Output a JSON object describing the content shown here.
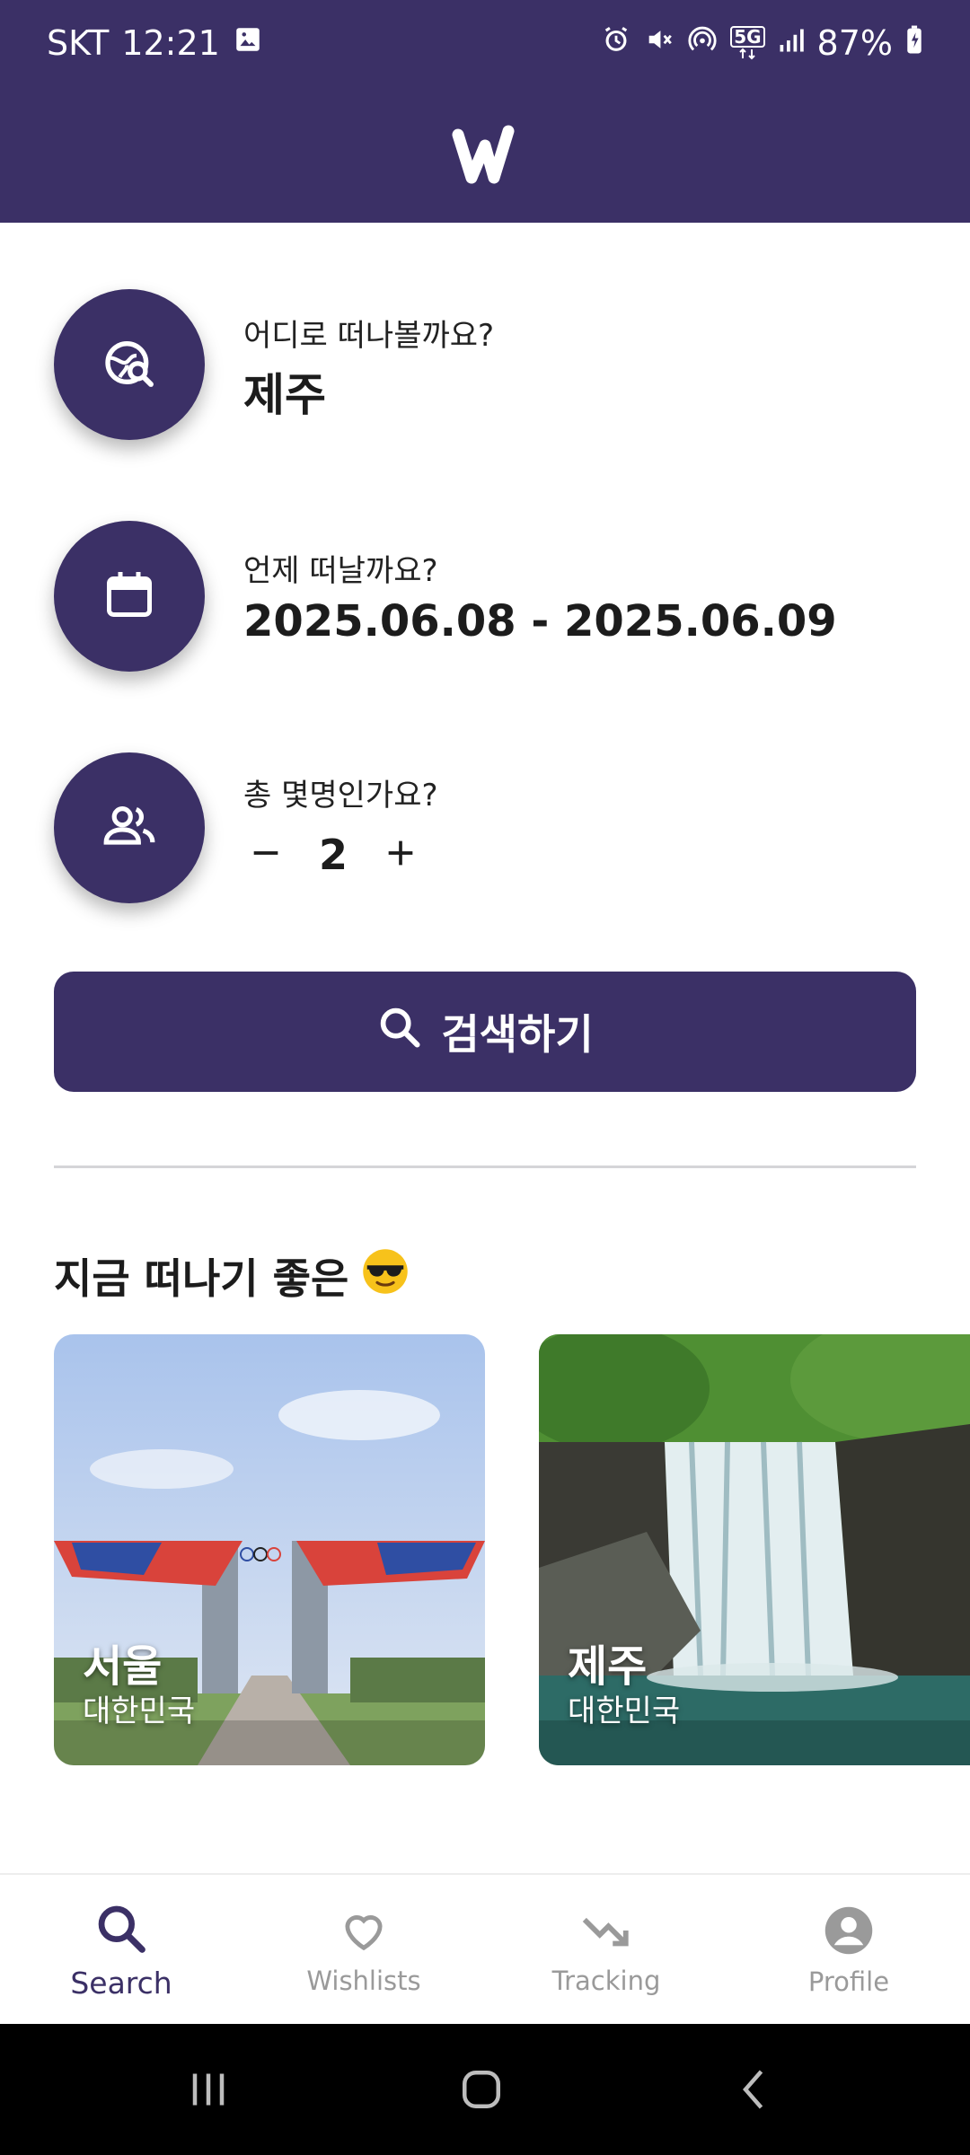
{
  "status_bar": {
    "carrier": "SKT",
    "time": "12:21",
    "battery": "87%",
    "network_badge": "5G",
    "icons": [
      "image-icon",
      "alarm-icon",
      "mute-icon",
      "hotspot-icon",
      "5g-icon",
      "signal-icon",
      "battery-charging-icon"
    ]
  },
  "app_bar": {
    "logo_icon": "w-logo-icon",
    "background": "#3b3066"
  },
  "search_form": {
    "destination": {
      "label": "어디로 떠나볼까요?",
      "value": "제주",
      "icon": "globe-search-icon"
    },
    "dates": {
      "label": "언제 떠날까요?",
      "value": "2025.06.08 - 2025.06.09",
      "icon": "calendar-icon"
    },
    "guests": {
      "label": "총 몇명인가요?",
      "count": "2",
      "decrement_icon": "minus-icon",
      "increment_icon": "plus-icon",
      "icon": "people-icon"
    },
    "search_button": {
      "label": "검색하기",
      "icon": "search-icon"
    }
  },
  "recommend": {
    "title": "지금 떠나기 좋은",
    "title_emoji": "😎",
    "cards": [
      {
        "city": "서울",
        "country": "대한민국",
        "image": "seoul-olympic-gate"
      },
      {
        "city": "제주",
        "country": "대한민국",
        "image": "jeju-waterfall"
      }
    ]
  },
  "bottom_nav": {
    "items": [
      {
        "label": "Search",
        "icon": "search-icon",
        "active": true
      },
      {
        "label": "Wishlists",
        "icon": "heart-icon",
        "active": false
      },
      {
        "label": "Tracking",
        "icon": "trend-down-icon",
        "active": false
      },
      {
        "label": "Profile",
        "icon": "profile-icon",
        "active": false
      }
    ]
  },
  "system_nav": {
    "icons": [
      "recents-icon",
      "home-icon",
      "back-icon"
    ]
  },
  "colors": {
    "primary": "#3b3066",
    "inactive": "#9a9a9a"
  }
}
